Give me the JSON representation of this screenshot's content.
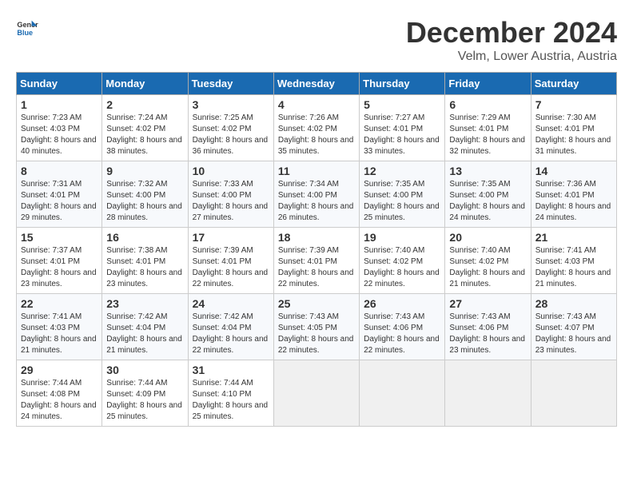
{
  "header": {
    "logo_general": "General",
    "logo_blue": "Blue",
    "month": "December 2024",
    "location": "Velm, Lower Austria, Austria"
  },
  "days_of_week": [
    "Sunday",
    "Monday",
    "Tuesday",
    "Wednesday",
    "Thursday",
    "Friday",
    "Saturday"
  ],
  "weeks": [
    [
      {
        "day": "1",
        "sunrise": "Sunrise: 7:23 AM",
        "sunset": "Sunset: 4:03 PM",
        "daylight": "Daylight: 8 hours and 40 minutes."
      },
      {
        "day": "2",
        "sunrise": "Sunrise: 7:24 AM",
        "sunset": "Sunset: 4:02 PM",
        "daylight": "Daylight: 8 hours and 38 minutes."
      },
      {
        "day": "3",
        "sunrise": "Sunrise: 7:25 AM",
        "sunset": "Sunset: 4:02 PM",
        "daylight": "Daylight: 8 hours and 36 minutes."
      },
      {
        "day": "4",
        "sunrise": "Sunrise: 7:26 AM",
        "sunset": "Sunset: 4:02 PM",
        "daylight": "Daylight: 8 hours and 35 minutes."
      },
      {
        "day": "5",
        "sunrise": "Sunrise: 7:27 AM",
        "sunset": "Sunset: 4:01 PM",
        "daylight": "Daylight: 8 hours and 33 minutes."
      },
      {
        "day": "6",
        "sunrise": "Sunrise: 7:29 AM",
        "sunset": "Sunset: 4:01 PM",
        "daylight": "Daylight: 8 hours and 32 minutes."
      },
      {
        "day": "7",
        "sunrise": "Sunrise: 7:30 AM",
        "sunset": "Sunset: 4:01 PM",
        "daylight": "Daylight: 8 hours and 31 minutes."
      }
    ],
    [
      {
        "day": "8",
        "sunrise": "Sunrise: 7:31 AM",
        "sunset": "Sunset: 4:01 PM",
        "daylight": "Daylight: 8 hours and 29 minutes."
      },
      {
        "day": "9",
        "sunrise": "Sunrise: 7:32 AM",
        "sunset": "Sunset: 4:00 PM",
        "daylight": "Daylight: 8 hours and 28 minutes."
      },
      {
        "day": "10",
        "sunrise": "Sunrise: 7:33 AM",
        "sunset": "Sunset: 4:00 PM",
        "daylight": "Daylight: 8 hours and 27 minutes."
      },
      {
        "day": "11",
        "sunrise": "Sunrise: 7:34 AM",
        "sunset": "Sunset: 4:00 PM",
        "daylight": "Daylight: 8 hours and 26 minutes."
      },
      {
        "day": "12",
        "sunrise": "Sunrise: 7:35 AM",
        "sunset": "Sunset: 4:00 PM",
        "daylight": "Daylight: 8 hours and 25 minutes."
      },
      {
        "day": "13",
        "sunrise": "Sunrise: 7:35 AM",
        "sunset": "Sunset: 4:00 PM",
        "daylight": "Daylight: 8 hours and 24 minutes."
      },
      {
        "day": "14",
        "sunrise": "Sunrise: 7:36 AM",
        "sunset": "Sunset: 4:01 PM",
        "daylight": "Daylight: 8 hours and 24 minutes."
      }
    ],
    [
      {
        "day": "15",
        "sunrise": "Sunrise: 7:37 AM",
        "sunset": "Sunset: 4:01 PM",
        "daylight": "Daylight: 8 hours and 23 minutes."
      },
      {
        "day": "16",
        "sunrise": "Sunrise: 7:38 AM",
        "sunset": "Sunset: 4:01 PM",
        "daylight": "Daylight: 8 hours and 23 minutes."
      },
      {
        "day": "17",
        "sunrise": "Sunrise: 7:39 AM",
        "sunset": "Sunset: 4:01 PM",
        "daylight": "Daylight: 8 hours and 22 minutes."
      },
      {
        "day": "18",
        "sunrise": "Sunrise: 7:39 AM",
        "sunset": "Sunset: 4:01 PM",
        "daylight": "Daylight: 8 hours and 22 minutes."
      },
      {
        "day": "19",
        "sunrise": "Sunrise: 7:40 AM",
        "sunset": "Sunset: 4:02 PM",
        "daylight": "Daylight: 8 hours and 22 minutes."
      },
      {
        "day": "20",
        "sunrise": "Sunrise: 7:40 AM",
        "sunset": "Sunset: 4:02 PM",
        "daylight": "Daylight: 8 hours and 21 minutes."
      },
      {
        "day": "21",
        "sunrise": "Sunrise: 7:41 AM",
        "sunset": "Sunset: 4:03 PM",
        "daylight": "Daylight: 8 hours and 21 minutes."
      }
    ],
    [
      {
        "day": "22",
        "sunrise": "Sunrise: 7:41 AM",
        "sunset": "Sunset: 4:03 PM",
        "daylight": "Daylight: 8 hours and 21 minutes."
      },
      {
        "day": "23",
        "sunrise": "Sunrise: 7:42 AM",
        "sunset": "Sunset: 4:04 PM",
        "daylight": "Daylight: 8 hours and 21 minutes."
      },
      {
        "day": "24",
        "sunrise": "Sunrise: 7:42 AM",
        "sunset": "Sunset: 4:04 PM",
        "daylight": "Daylight: 8 hours and 22 minutes."
      },
      {
        "day": "25",
        "sunrise": "Sunrise: 7:43 AM",
        "sunset": "Sunset: 4:05 PM",
        "daylight": "Daylight: 8 hours and 22 minutes."
      },
      {
        "day": "26",
        "sunrise": "Sunrise: 7:43 AM",
        "sunset": "Sunset: 4:06 PM",
        "daylight": "Daylight: 8 hours and 22 minutes."
      },
      {
        "day": "27",
        "sunrise": "Sunrise: 7:43 AM",
        "sunset": "Sunset: 4:06 PM",
        "daylight": "Daylight: 8 hours and 23 minutes."
      },
      {
        "day": "28",
        "sunrise": "Sunrise: 7:43 AM",
        "sunset": "Sunset: 4:07 PM",
        "daylight": "Daylight: 8 hours and 23 minutes."
      }
    ],
    [
      {
        "day": "29",
        "sunrise": "Sunrise: 7:44 AM",
        "sunset": "Sunset: 4:08 PM",
        "daylight": "Daylight: 8 hours and 24 minutes."
      },
      {
        "day": "30",
        "sunrise": "Sunrise: 7:44 AM",
        "sunset": "Sunset: 4:09 PM",
        "daylight": "Daylight: 8 hours and 25 minutes."
      },
      {
        "day": "31",
        "sunrise": "Sunrise: 7:44 AM",
        "sunset": "Sunset: 4:10 PM",
        "daylight": "Daylight: 8 hours and 25 minutes."
      },
      null,
      null,
      null,
      null
    ]
  ]
}
